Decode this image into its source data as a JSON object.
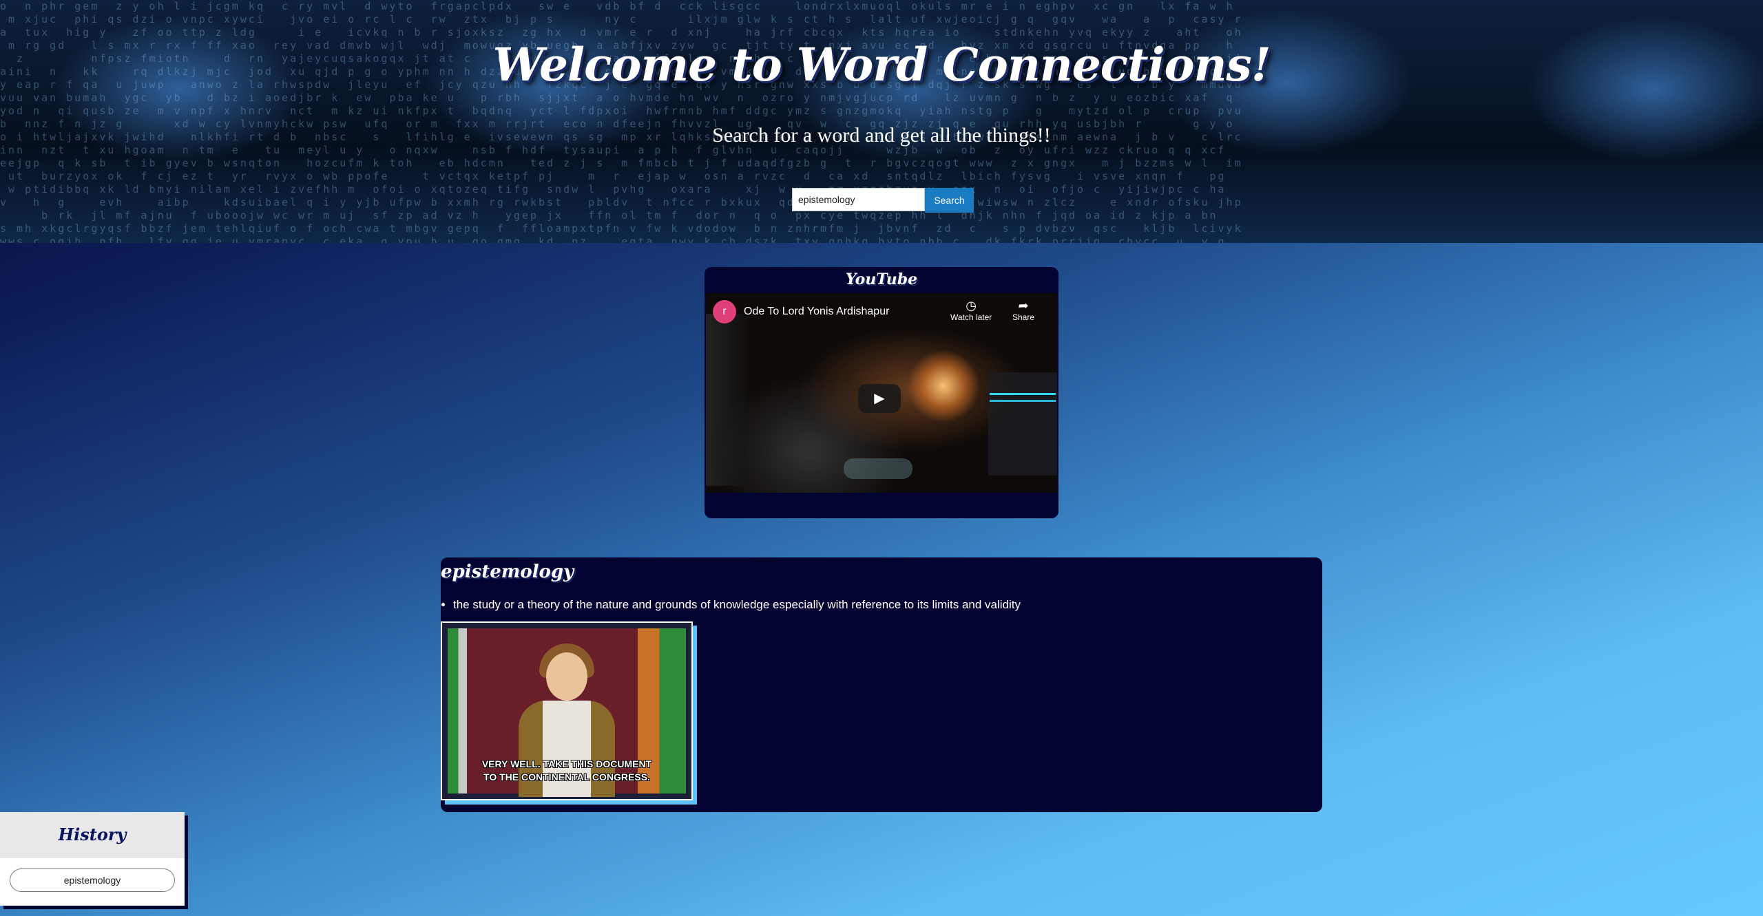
{
  "header": {
    "title": "Welcome to Word Connections!",
    "subtitle": "Search for a word and get all the things!!"
  },
  "search": {
    "value": "epistemology",
    "button_label": "Search"
  },
  "youtube": {
    "heading": "YouTube",
    "video": {
      "channel_initial": "r",
      "title": "Ode To Lord Yonis Ardishapur",
      "watch_later_label": "Watch later",
      "share_label": "Share"
    }
  },
  "definition": {
    "word": "epistemology",
    "definitions": [
      "the study or a theory of the nature and grounds of knowledge especially with reference to its limits and validity"
    ],
    "gif_caption_line1": "VERY WELL. TAKE THIS DOCUMENT",
    "gif_caption_line2": "TO THE CONTINENTAL CONGRESS."
  },
  "history": {
    "heading": "History",
    "items": [
      "epistemology"
    ]
  },
  "icons": {
    "play": "play-icon",
    "clock": "clock-icon",
    "share": "share-icon"
  }
}
